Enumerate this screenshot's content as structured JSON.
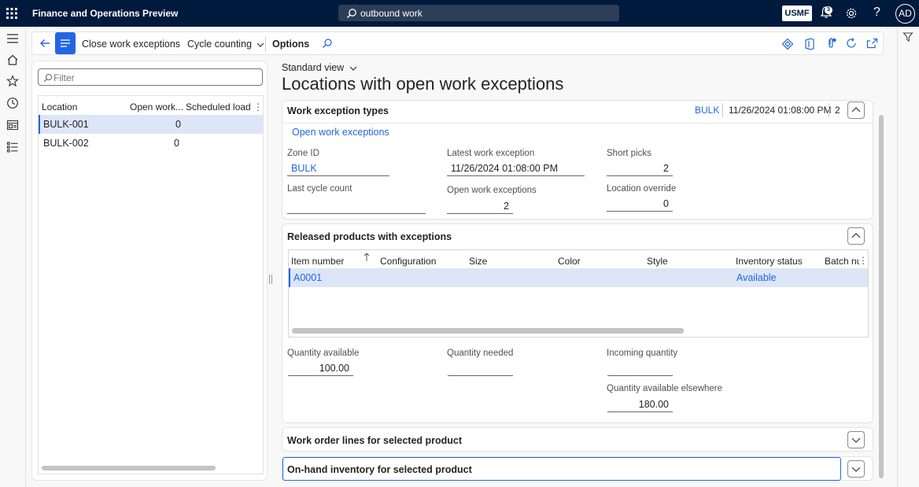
{
  "topbar": {
    "app_title": "Finance and Operations Preview",
    "search_text": "outbound work",
    "company": "USMF",
    "notifications_count": "3",
    "help": "?",
    "avatar": "AD"
  },
  "actionpane": {
    "close_work_exceptions": "Close work exceptions",
    "cycle_counting": "Cycle counting",
    "options": "Options"
  },
  "list": {
    "filter_placeholder": "Filter",
    "columns": [
      "Location",
      "Open work...",
      "Scheduled load"
    ],
    "rows": [
      {
        "location": "BULK-001",
        "open_work": "0",
        "scheduled_load": ""
      },
      {
        "location": "BULK-002",
        "open_work": "0",
        "scheduled_load": ""
      }
    ]
  },
  "main": {
    "view_name": "Standard view",
    "page_title": "Locations with open work exceptions"
  },
  "work_exception_types": {
    "title": "Work exception types",
    "summary_zone": "BULK",
    "summary_date": "11/26/2024 01:08:00 PM",
    "summary_count": "2",
    "open_link": "Open work exceptions",
    "zone_id_label": "Zone ID",
    "zone_id_value": "BULK",
    "latest_label": "Latest work exception",
    "latest_value": "11/26/2024 01:08:00 PM",
    "short_picks_label": "Short picks",
    "short_picks_value": "2",
    "last_cycle_label": "Last cycle count",
    "last_cycle_value": "",
    "open_work_label": "Open work exceptions",
    "open_work_value": "2",
    "location_override_label": "Location override",
    "location_override_value": "0"
  },
  "released_products": {
    "title": "Released products with exceptions",
    "columns": [
      "Item number",
      "Configuration",
      "Size",
      "Color",
      "Style",
      "Inventory status",
      "Batch nu"
    ],
    "rows": [
      {
        "item": "A0001",
        "configuration": "",
        "size": "",
        "color": "",
        "style": "",
        "status": "Available",
        "batch": ""
      }
    ],
    "qty_available_label": "Quantity available",
    "qty_available_value": "100.00",
    "qty_needed_label": "Quantity needed",
    "qty_needed_value": "",
    "incoming_label": "Incoming quantity",
    "incoming_value": "",
    "elsewhere_label": "Quantity available elsewhere",
    "elsewhere_value": "180.00"
  },
  "work_order_lines": {
    "title": "Work order lines for selected product"
  },
  "onhand": {
    "title": "On-hand inventory for selected product"
  },
  "colors": {
    "topbar": "#001a3d",
    "accent": "#2266e3",
    "selected_row": "#dce6f7"
  },
  "icons": [
    "waffle-icon",
    "search-icon",
    "bell-icon",
    "gear-icon",
    "hamburger-icon",
    "home-icon",
    "star-icon",
    "clock-icon",
    "workspace-icon",
    "list-icon",
    "back-arrow-icon",
    "filter-icon"
  ]
}
